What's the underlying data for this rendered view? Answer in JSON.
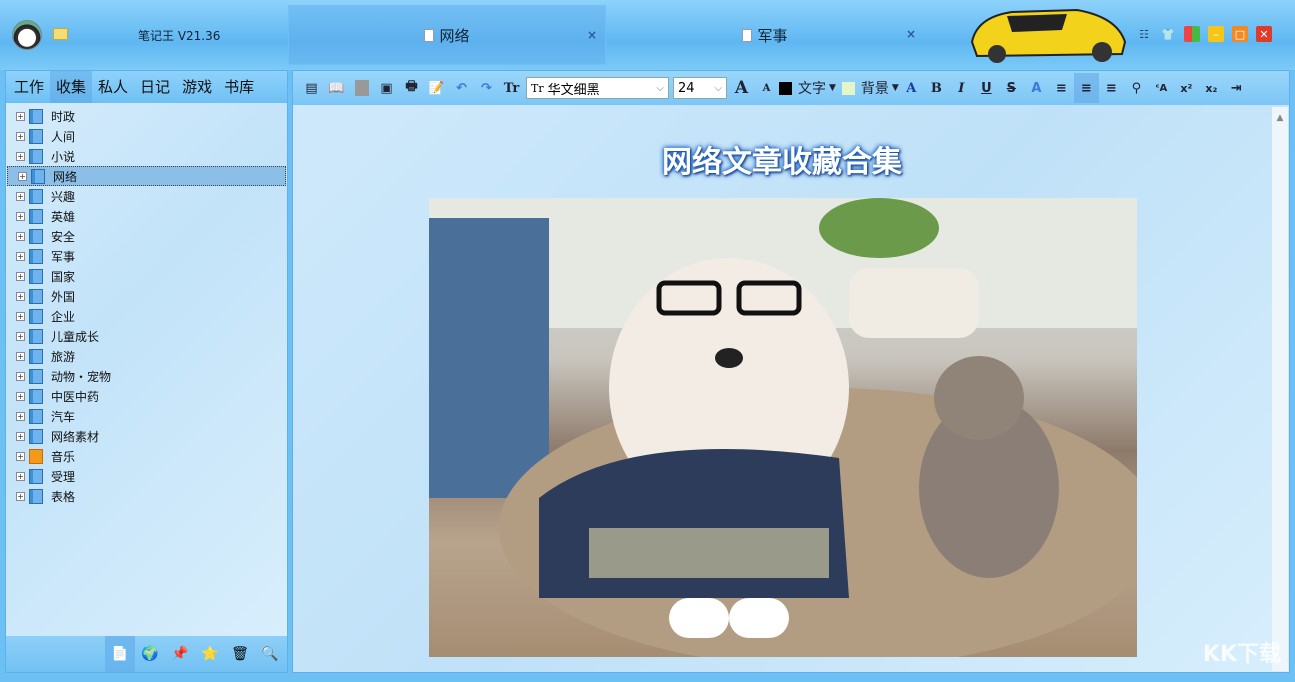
{
  "app": {
    "title": "笔记王 V21.36"
  },
  "tabs": [
    {
      "label": "网络",
      "close": "×"
    },
    {
      "label": "军事",
      "close": "×"
    }
  ],
  "left_tabs": [
    "工作",
    "收集",
    "私人",
    "日记",
    "游戏",
    "书库"
  ],
  "tree": [
    "时政",
    "人间",
    "小说",
    "网络",
    "兴趣",
    "英雄",
    "安全",
    "军事",
    "国家",
    "外国",
    "企业",
    "儿童成长",
    "旅游",
    "动物・宠物",
    "中医中药",
    "汽车",
    "网络素材",
    "音乐",
    "受理",
    "表格"
  ],
  "toolbar": {
    "font": "华文细黑",
    "font_prefix": "Tr",
    "size": "24",
    "text_color_label": "文字",
    "bg_color_label": "背景",
    "text_color": "#000000",
    "bg_color": "#e6f5c8"
  },
  "document": {
    "title": "网络文章收藏合集"
  },
  "watermark": "KK下载"
}
